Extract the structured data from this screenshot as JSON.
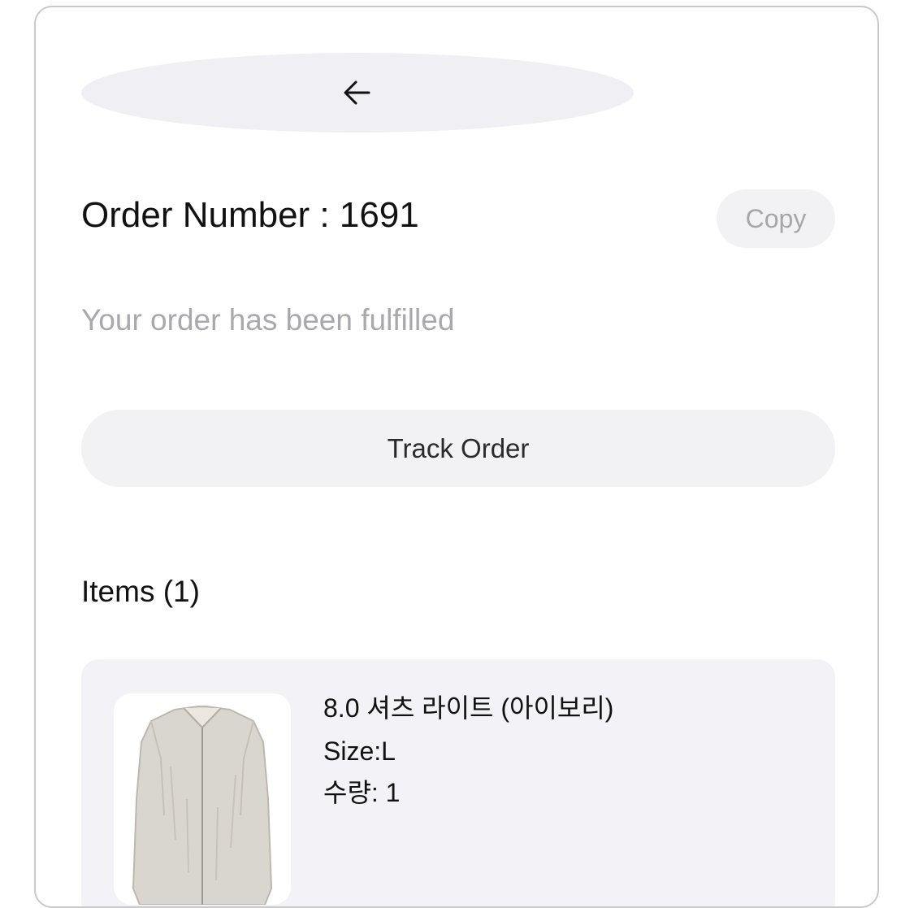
{
  "header": {
    "back_icon": "arrow-left-icon"
  },
  "order": {
    "title": "Order Number : 1691",
    "copy_label": "Copy",
    "status": "Your order has been fulfilled",
    "track_label": "Track Order"
  },
  "items": {
    "heading": "Items (1)",
    "list": [
      {
        "name": "8.0 셔츠 라이트 (아이보리)",
        "size": "Size:L",
        "quantity": "수량: 1",
        "image_icon": "shirt-thumbnail"
      }
    ]
  },
  "colors": {
    "pill_background": "#efeff4",
    "muted_text": "#a9a9ad",
    "item_card_background": "#f3f3f7"
  }
}
